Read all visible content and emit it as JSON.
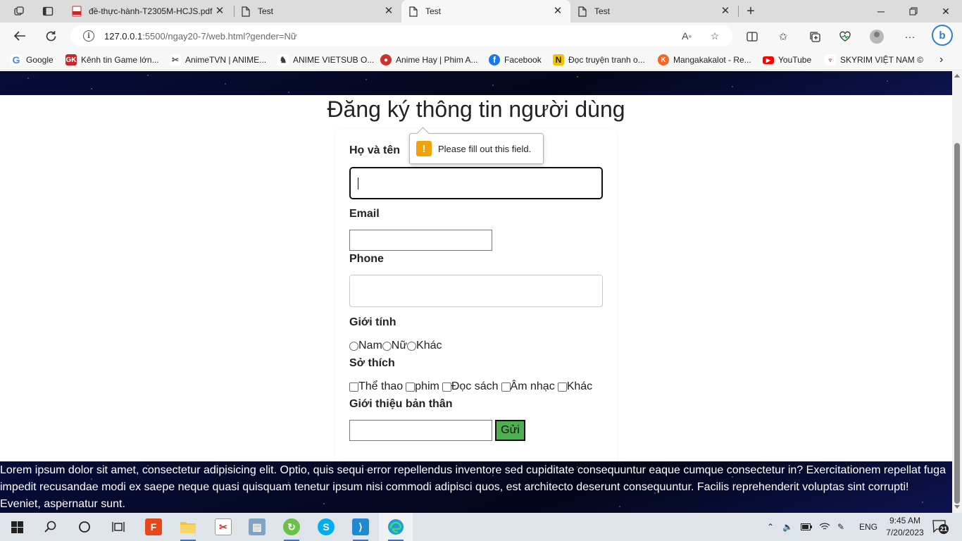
{
  "browser": {
    "tabs": [
      {
        "title": "đề-thực-hành-T2305M-HCJS.pdf",
        "icon": "pdf-icon",
        "active": false
      },
      {
        "title": "Test",
        "icon": "page-icon",
        "active": false
      },
      {
        "title": "Test",
        "icon": "page-icon",
        "active": true
      },
      {
        "title": "Test",
        "icon": "page-icon",
        "active": false
      }
    ],
    "url_host": "127.0.0.1",
    "url_rest": ":5500/ngay20-7/web.html?gender=Nữ",
    "bookmarks": [
      {
        "label": "Google",
        "icon": "google-icon",
        "color": "#4285f4"
      },
      {
        "label": "Kênh tin Game lớn...",
        "icon": "gk-icon",
        "color": "#c62828"
      },
      {
        "label": "AnimeTVN | ANIME...",
        "icon": "animetvn-icon",
        "color": "#555555"
      },
      {
        "label": "ANIME VIETSUB O...",
        "icon": "anime-vietsub-icon",
        "color": "#3a3a3a"
      },
      {
        "label": "Anime Hay | Phim A...",
        "icon": "animehay-icon",
        "color": "#d32f2f"
      },
      {
        "label": "Facebook",
        "icon": "facebook-icon",
        "color": "#1877f2"
      },
      {
        "label": "Đọc truyện tranh o...",
        "icon": "truyen-icon",
        "color": "#f2c200"
      },
      {
        "label": "Mangakakalot - Re...",
        "icon": "mangakakalot-icon",
        "color": "#f26522"
      },
      {
        "label": "YouTube",
        "icon": "youtube-icon",
        "color": "#ff0000"
      },
      {
        "label": "SKYRIM VIỆT NAM ©",
        "icon": "skyrim-icon",
        "color": "#b71c1c"
      }
    ]
  },
  "form": {
    "title": "Đăng ký thông tin người dùng",
    "name_label": "Họ và tên",
    "email_label": "Email",
    "phone_label": "Phone",
    "gender_label": "Giới tính",
    "gender_options": [
      "Nam",
      "Nữ",
      "Khác"
    ],
    "hobby_label": "Sở thích",
    "hobby_options": [
      "Thể thao",
      "phim",
      "Đọc sách",
      "Âm nhạc",
      "Khác"
    ],
    "bio_label": "Giới thiệu bản thân",
    "submit_label": "Gửi",
    "validation_message": "Please fill out this field."
  },
  "footer_text": "Lorem ipsum dolor sit amet, consectetur adipisicing elit. Optio, quis sequi error repellendus inventore sed cupiditate consequuntur eaque cumque consectetur in? Exercitationem repellat fuga impedit recusandae modi ex saepe neque quasi quisquam tenetur ipsum nisi commodi adipisci quos, est architecto deserunt consequuntur. Facilis reprehenderit voluptas sint corrupti! Eveniet, aspernatur sunt.",
  "taskbar": {
    "language": "ENG",
    "time": "9:45 AM",
    "date": "7/20/2023",
    "notifications": "21"
  },
  "colors": {
    "submit_button": "#4caf50",
    "warning": "#f3a10a",
    "page_banner": "#050a2a"
  }
}
